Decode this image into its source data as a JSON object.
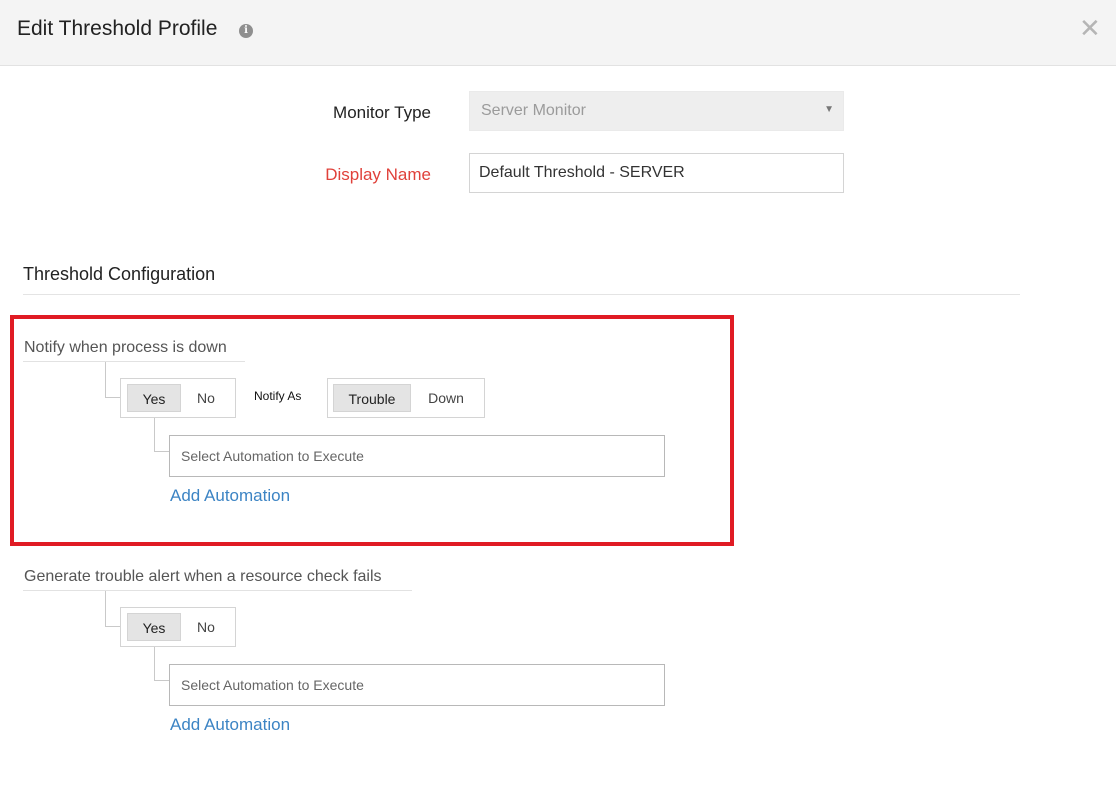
{
  "dialog": {
    "title": "Edit Threshold Profile",
    "info_icon": "info-icon",
    "close_icon": "close-icon",
    "close_glyph": "✕"
  },
  "form": {
    "monitor_type_label": "Monitor Type",
    "monitor_type_value": "Server Monitor",
    "display_name_label": "Display Name",
    "display_name_value": "Default Threshold - SERVER"
  },
  "section": {
    "title": "Threshold Configuration"
  },
  "rules": [
    {
      "label": "Notify when process is down",
      "toggle": {
        "options": [
          "Yes",
          "No"
        ],
        "selected": "Yes"
      },
      "notify_as_label": "Notify As",
      "notify_as": {
        "options": [
          "Trouble",
          "Down"
        ],
        "selected": "Trouble"
      },
      "automation_placeholder": "Select Automation to Execute",
      "add_automation": "Add Automation"
    },
    {
      "label": "Generate trouble alert when a resource check fails",
      "toggle": {
        "options": [
          "Yes",
          "No"
        ],
        "selected": "Yes"
      },
      "automation_placeholder": "Select Automation to Execute",
      "add_automation": "Add Automation"
    }
  ],
  "colors": {
    "required_label": "#e0413a",
    "link": "#3c84c4",
    "highlight": "#e01b24",
    "header_bg": "#f4f4f4"
  }
}
